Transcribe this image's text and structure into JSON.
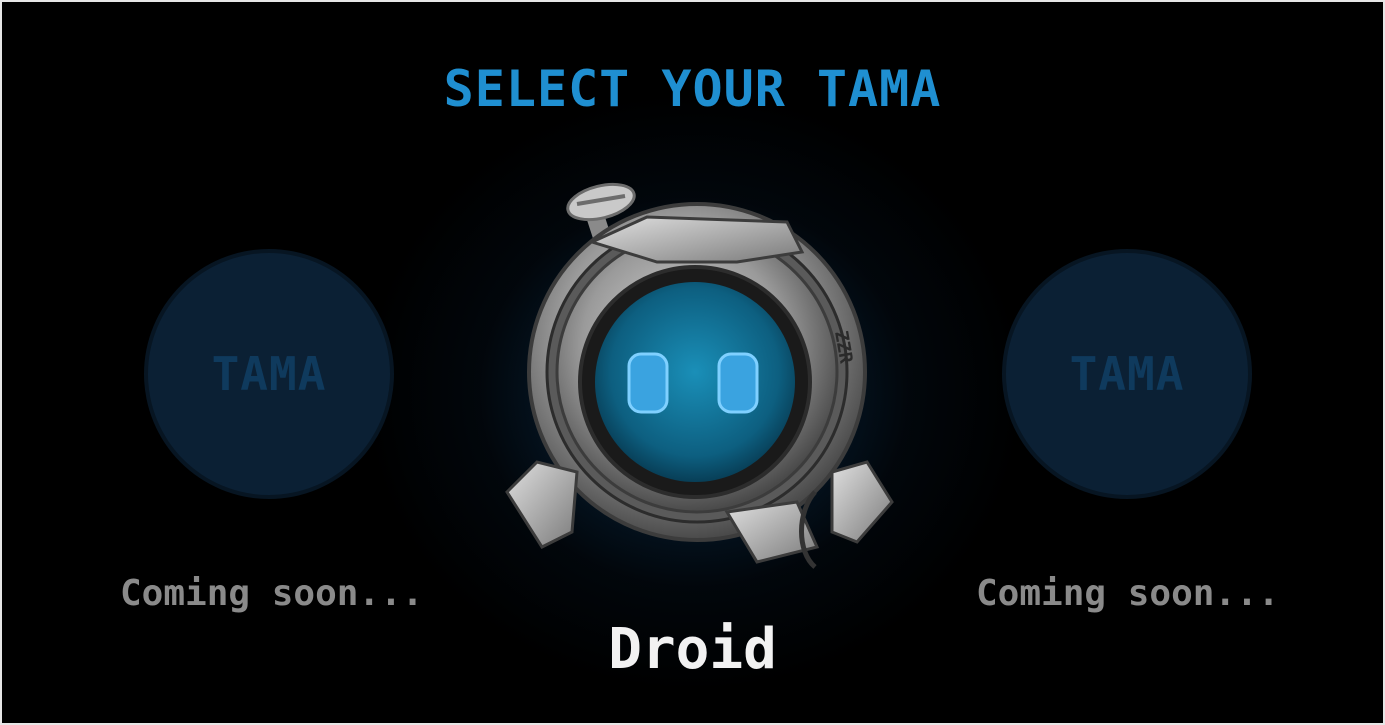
{
  "header": {
    "title": "SELECT YOUR TAMA"
  },
  "slots": {
    "left": {
      "label": "TAMA",
      "status": "Coming soon..."
    },
    "right": {
      "label": "TAMA",
      "status": "Coming soon..."
    }
  },
  "selected": {
    "name": "Droid"
  },
  "colors": {
    "title": "#1f8fd1",
    "slot_fill": "#0b2034",
    "slot_text": "#0f3a5d",
    "status_text": "#8a8a8a",
    "name_text": "#f2f2f2",
    "eye": "#3aa3e0"
  },
  "icons": {
    "robot": "droid-robot-icon"
  }
}
